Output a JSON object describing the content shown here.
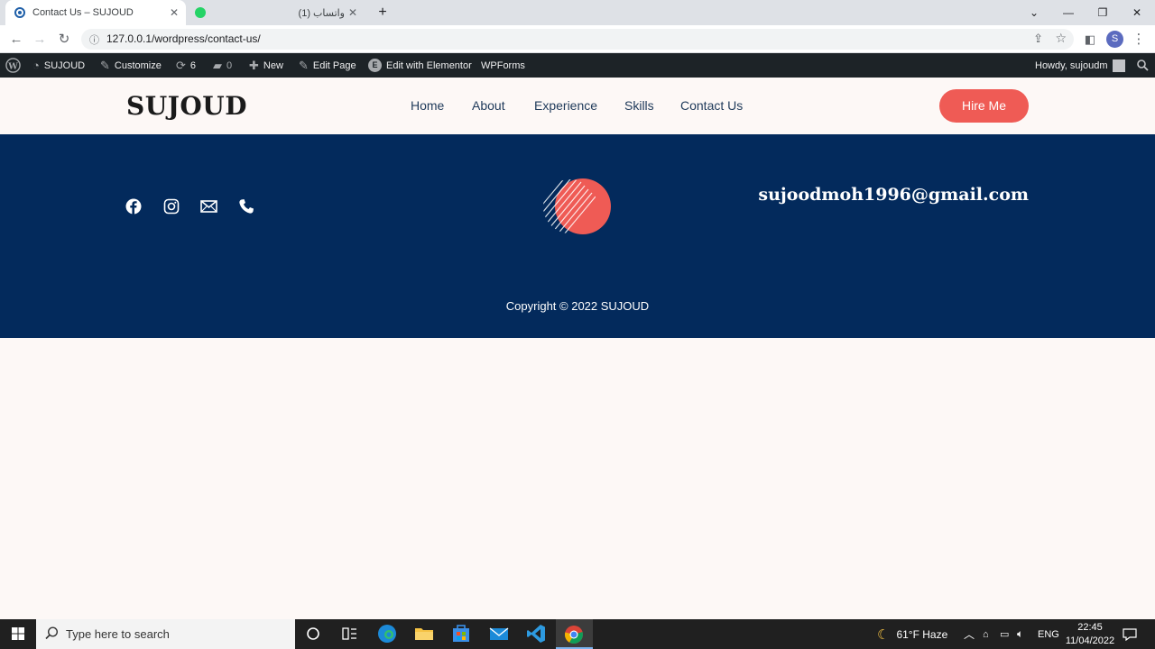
{
  "browser": {
    "tabs": [
      {
        "title": "Contact Us – SUJOUD",
        "active": true
      },
      {
        "title": "(1) واتساب",
        "active": false
      }
    ],
    "new_tab_label": "+",
    "url": "127.0.0.1/wordpress/contact-us/",
    "profile_initial": "S"
  },
  "adminbar": {
    "site_name": "SUJOUD",
    "customize": "Customize",
    "updates_count": "6",
    "comments_count": "0",
    "new": "New",
    "edit_page": "Edit Page",
    "elementor": "Edit with Elementor",
    "wpforms": "WPForms",
    "howdy": "Howdy, sujoudm"
  },
  "site": {
    "logo": "SUJOUD",
    "nav": [
      "Home",
      "About",
      "Experience",
      "Skills",
      "Contact Us"
    ],
    "cta": "Hire Me"
  },
  "footer": {
    "social_icons": [
      "facebook-icon",
      "instagram-icon",
      "mail-icon",
      "phone-icon"
    ],
    "email": "sujoodmoh1996@gmail.com",
    "copyright": "Copyright © 2022 SUJOUD"
  },
  "taskbar": {
    "search_placeholder": "Type here to search",
    "weather": "61°F  Haze",
    "language": "ENG",
    "time": "22:45",
    "date": "11/04/2022"
  },
  "colors": {
    "footer_bg": "#032a5c",
    "accent": "#ef5b55",
    "adminbar_bg": "#1d2327",
    "page_bg": "#fdf8f6"
  }
}
